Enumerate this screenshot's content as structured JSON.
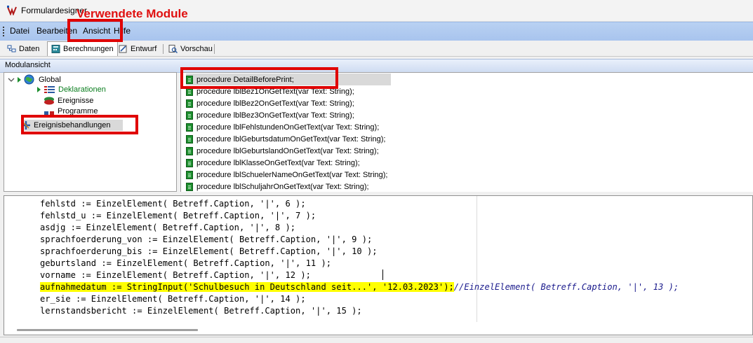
{
  "window": {
    "title": "Formulardesigner"
  },
  "annotation": {
    "label": "Verwendete Module"
  },
  "menu": {
    "items": [
      "Datei",
      "Bearbeiten",
      "Ansicht",
      "Hilfe"
    ]
  },
  "tabs": [
    {
      "label": "Daten",
      "icon": "data-icon"
    },
    {
      "label": "Berechnungen",
      "icon": "calculator-icon",
      "active": true
    },
    {
      "label": "Entwurf",
      "icon": "design-icon"
    },
    {
      "label": "Vorschau",
      "icon": "preview-icon"
    }
  ],
  "module_view": {
    "header": "Modulansicht",
    "tree": {
      "root": "Global",
      "children": [
        "Deklarationen",
        "Ereignisse",
        "Programme"
      ],
      "event_handlers": "Ereignisbehandlungen"
    }
  },
  "procedures": [
    "procedure DetailBeforePrint;",
    "procedure lblBez1OnGetText(var Text: String);",
    "procedure lblBez2OnGetText(var Text: String);",
    "procedure lblBez3OnGetText(var Text: String);",
    "procedure lblFehlstundenOnGetText(var Text: String);",
    "procedure lblGeburtsdatumOnGetText(var Text: String);",
    "procedure lblGeburtslandOnGetText(var Text: String);",
    "procedure lblKlasseOnGetText(var Text: String);",
    "procedure lblSchuelerNameOnGetText(var Text: String);",
    "procedure lblSchuljahrOnGetText(var Text: String);"
  ],
  "code": {
    "lines_before": [
      "fehlstd := EinzelElement( Betreff.Caption, '|', 6 );",
      "fehlstd_u := EinzelElement( Betreff.Caption, '|', 7 );",
      "asdjg := EinzelElement( Betreff.Caption, '|', 8 );",
      "sprachfoerderung_von := EinzelElement( Betreff.Caption, '|', 9 );",
      "sprachfoerderung_bis := EinzelElement( Betreff.Caption, '|', 10 );",
      "geburtsland := EinzelElement( Betreff.Caption, '|', 11 );",
      "vorname := EinzelElement( Betreff.Caption, '|', 12 );"
    ],
    "highlighted": "aufnahmedatum := StringInput('Schulbesuch in Deutschland seit...', '12.03.2023');",
    "highlighted_comment": "//EinzelElement( Betreff.Caption, '|', 13 );",
    "lines_after": [
      "er_sie := EinzelElement( Betreff.Caption, '|', 14 );",
      "lernstandsbericht := EinzelElement( Betreff.Caption, '|', 15 );"
    ]
  },
  "colors": {
    "highlight": "#ffff00",
    "annotation": "#e00000",
    "menubar": "#b9d1f2"
  }
}
